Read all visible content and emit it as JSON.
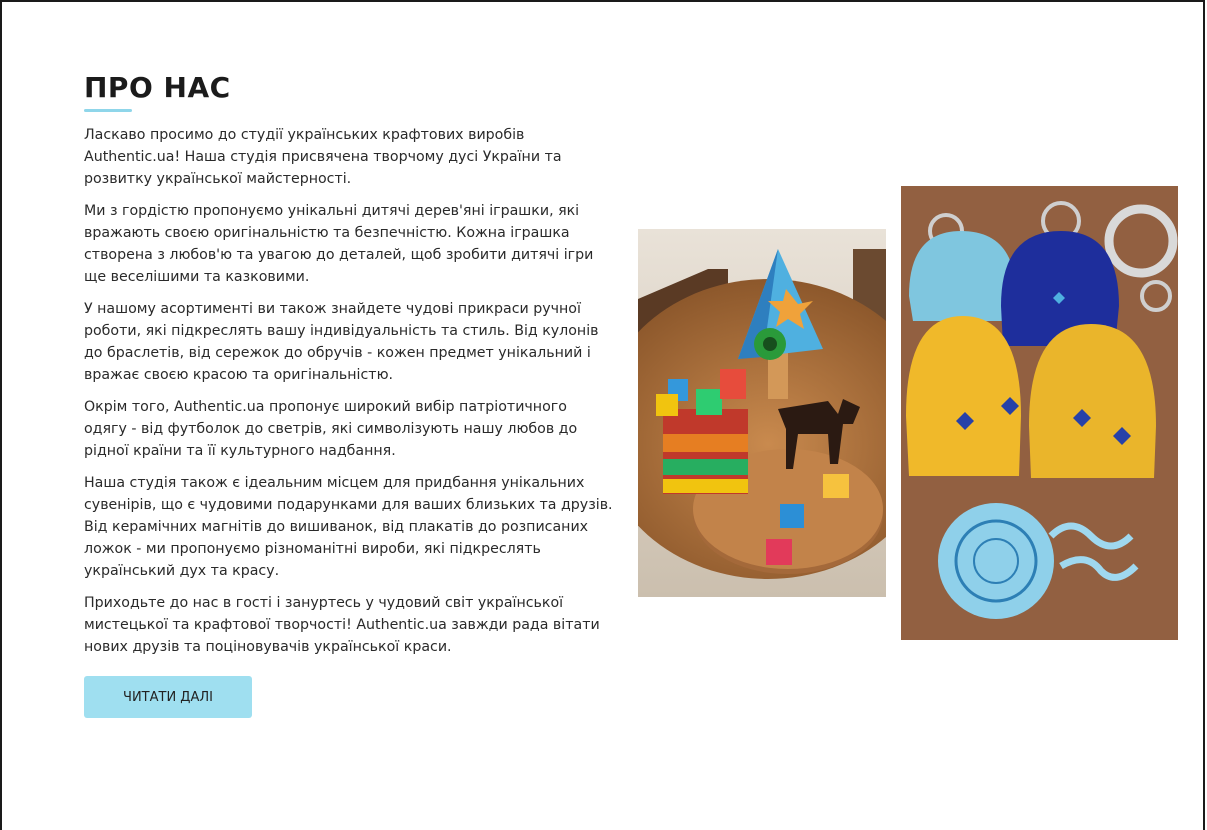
{
  "about": {
    "title": "ПРО НАС",
    "paragraphs": [
      "Ласкаво просимо до студії українських крафтових виробів Authentic.ua! Наша студія присвячена творчому дусі України та розвитку української майстерності.",
      "Ми з гордістю пропонуємо унікальні дитячі дерев'яні іграшки, які вражають своєю оригінальністю та безпечністю. Кожна іграшка створена з любов'ю та увагою до деталей, щоб зробити дитячі ігри ще веселішими та казковими.",
      "У нашому асортименті ви також знайдете чудові прикраси ручної роботи, які підкреслять вашу індивідуальність та стиль. Від кулонів до браслетів, від сережок до обручів - кожен предмет унікальний і вражає своєю красою та оригінальністю.",
      "Окрім того, Authentic.ua пропонує широкий вибір патріотичного одягу - від футболок до светрів, які символізують нашу любов до рідної країни та її культурного надбання.",
      "Наша студія також є ідеальним місцем для придбання унікальних сувенірів, що є чудовими подарунками для ваших близьких та друзів. Від керамічних магнітів до вишиванок, від плакатів до розписаних ложок - ми пропонуємо різноманітні вироби, які підкреслять український дух та красу.",
      "Приходьте до нас в гості і зануртесь у чудовий світ української мистецької та крафтової творчості! Authentic.ua завжди рада вітати нових друзів та поціновувачів української краси."
    ],
    "button_label": "ЧИТАТИ ДАЛІ"
  },
  "colors": {
    "accent": "#9fdff0",
    "underline": "#8fd6ea",
    "text": "#2a2a2a"
  }
}
